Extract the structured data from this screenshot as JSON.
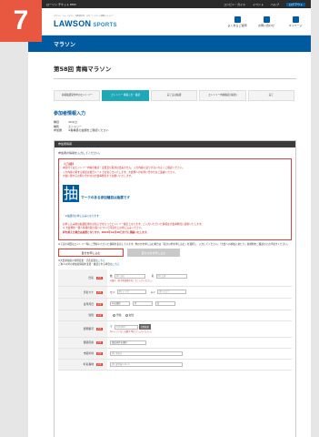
{
  "step_badge": "7",
  "topbar": {
    "left": "ローソン チケット HMV",
    "links": [
      "コンビニ・ガイド",
      "イベント",
      "ヘルプ",
      "ログアウト"
    ]
  },
  "header": {
    "tagline": "マラソン・トレイルラン・自転車大会・スポーツイベント情報 エントリー",
    "brand": "LAWSON",
    "brand_sub": "SPORTS",
    "icons": [
      {
        "label": "よくあるご質問"
      },
      {
        "label": "お問い合わせ"
      },
      {
        "label": "マイページ"
      }
    ]
  },
  "hero": {
    "title": "マラソン"
  },
  "event_title": "第58回 青梅マラソン",
  "steps": [
    {
      "label": "先着抽選受付中のエントリー"
    },
    {
      "label": "エントリー 情報入力・確認"
    },
    {
      "label": "完了又は抽選"
    },
    {
      "label": "エントリー内容確認 (振替)"
    },
    {
      "label": "完了"
    }
  ],
  "section_title": "参加者情報入力",
  "info": [
    {
      "k": "種目",
      "v": "30キロ"
    },
    {
      "k": "種別",
      "v": "エントリー"
    },
    {
      "k": "参加費",
      "v": "※各種目の金額をご確認ください"
    }
  ],
  "panel": {
    "head": "参加者情報",
    "intro": "参加者の情報を入力してください。",
    "notice": {
      "heading": "【ご注意】",
      "lines": [
        "本受付ではエントリー内容の確認・変更及び取消は出来ません。入力内容に誤りがないかよくご確認ください。",
        "入力内容に関する確認は後日メールでお知らせいたします。大会側へのお問い合わせはご遠慮ください。",
        "大会に関するお問い合わせは大会事務局までお願いいたします。"
      ],
      "lottery_mark": "抽",
      "lottery_title": "マークのある参加種目は抽選です",
      "lottery_sub": "・※抽選のお申し込みになります",
      "more": [
        "お申し込み後は抽選結果のお知らせをもってエントリー確定となります。ご入力いただいた情報は大会事務局に提供いたします。",
        "※ 大会規約・個人情報の取り扱いについて同意の上お申し込みください。"
      ],
      "deadline": "枠を超えた場合は抽選となります。2023年12月26日までに連絡いたします。"
    },
    "small": "※下記の項目はエントリー時にご登録いただいた情報を表示しています。他の方を申し込む場合は「自分以外を申し込む」を選択し、入力してください。「大会への参加にあたり」各規約をご確認の上お手続きください。",
    "btn_own": "自分を申し込む",
    "btn_other": "自分以外を申し込む",
    "link_note_a": "※大会参加者の住所変更・氏名変更は",
    "link_note_link": "こちら",
    "link_note_b": "ご本人以外の参加者情報を変更・確認される場合は",
    "link_note_link2": "こちら",
    "fields": [
      {
        "label": "氏名",
        "parts": [
          {
            "p": "姓",
            "ph": "例) 山田"
          },
          {
            "p": "名",
            "ph": "例) 太郎"
          }
        ],
        "note": "※漢字（外字等使用不可）でご入力ください。"
      },
      {
        "label": "氏名カナ",
        "parts": [
          {
            "p": "セイ",
            "ph": "例) ヤマダ"
          },
          {
            "p": "メイ",
            "ph": "例) タロウ"
          }
        ],
        "note": ""
      },
      {
        "label": "生年月日",
        "selects": [
          "年を選択",
          "月",
          "日"
        ],
        "note": ""
      },
      {
        "label": "性別",
        "radios": [
          "男性",
          "女性"
        ],
        "note": ""
      },
      {
        "label": "郵便番号",
        "parts": [
          {
            "p": "〒",
            "ph": "1234567"
          }
        ],
        "btn": "住所検索",
        "note": "※ハイフンなしの数字7桁でご入力ください。"
      },
      {
        "label": "都道府県",
        "selects": [
          "都道府県を選択"
        ],
        "note": ""
      },
      {
        "label": "市区町村",
        "parts": [
          {
            "p": "",
            "ph": "例) 青梅市"
          }
        ],
        "note": ""
      },
      {
        "label": "町名番地",
        "parts": [
          {
            "p": "",
            "ph": "例) 東青梅1-11-1"
          }
        ],
        "note": ""
      }
    ],
    "required": "必須"
  }
}
